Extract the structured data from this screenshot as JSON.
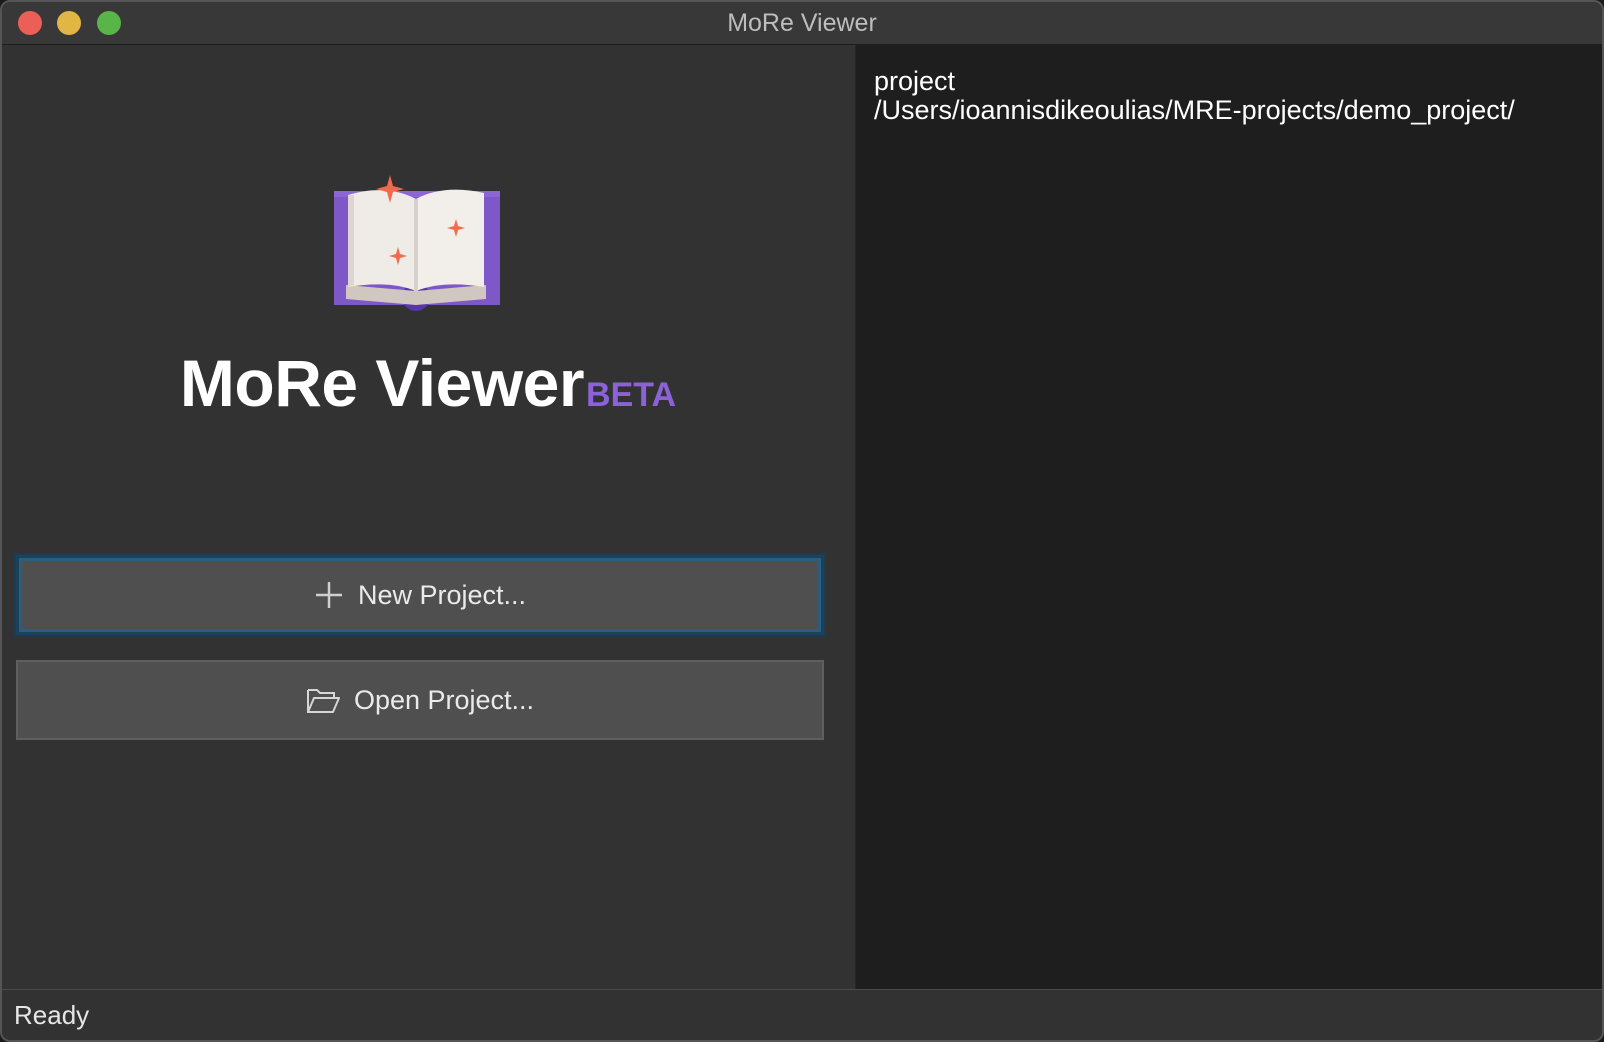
{
  "window": {
    "title": "MoRe Viewer"
  },
  "app": {
    "name": "MoRe Viewer",
    "badge": "BETA",
    "logo_icon": "open-book-icon",
    "accent_color": "#8c62d8"
  },
  "actions": {
    "new_project_label": "New Project...",
    "new_project_icon": "plus-icon",
    "open_project_label": "Open Project...",
    "open_project_icon": "folder-icon"
  },
  "projects": {
    "items": [
      {
        "name": "project",
        "path": "/Users/ioannisdikeoulias/MRE-projects/demo_project/"
      }
    ]
  },
  "status": {
    "text": "Ready"
  }
}
